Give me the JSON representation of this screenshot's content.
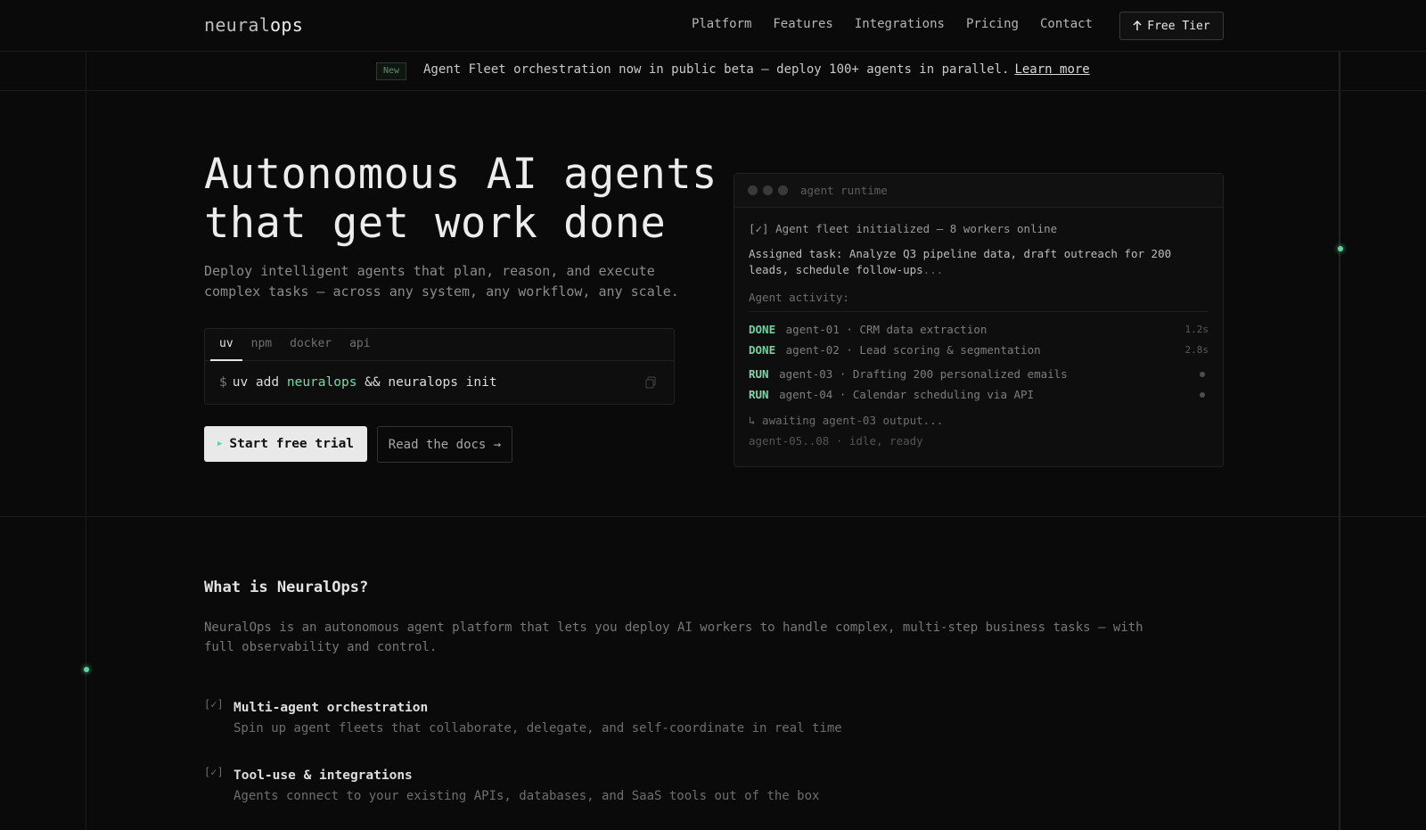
{
  "brand": {
    "logo_light": "neural",
    "logo_bold": "ops"
  },
  "nav": {
    "items": [
      "Platform",
      "Features",
      "Integrations",
      "Pricing",
      "Contact"
    ],
    "cta": "Free Tier",
    "cta_icon": "arrow-up-icon"
  },
  "banner": {
    "badge": "New",
    "text": "Agent Fleet orchestration now in public beta — deploy 100+ agents in parallel.",
    "link": "Learn more"
  },
  "hero": {
    "title_line1": "Autonomous AI agents",
    "title_line2": "that get work done",
    "subtitle": "Deploy intelligent agents that plan, reason, and execute complex tasks — across any system, any workflow, any scale.",
    "install": {
      "tabs": [
        "uv",
        "npm",
        "docker",
        "api"
      ],
      "active_tab": "uv",
      "prompt": "$",
      "cmd_pre": "uv add",
      "cmd_pkg": "neuralops",
      "cmd_post": "&& neuralops init"
    },
    "primary_button": "Start free trial",
    "secondary_button": "Read the docs →"
  },
  "terminal": {
    "title": "agent runtime",
    "init_line": "[✓] Agent fleet initialized — 8 workers online",
    "task": "Assigned task: Analyze Q3 pipeline data, draft outreach for 200 leads, schedule follow-ups",
    "task_ellipsis": "...",
    "activity_label": "Agent activity:",
    "rows": [
      {
        "status": "DONE",
        "text": "agent-01 · CRM data extraction",
        "time": "1.2s"
      },
      {
        "status": "DONE",
        "text": "agent-02 · Lead scoring & segmentation",
        "time": "2.8s"
      },
      {
        "status": "RUN",
        "text": "agent-03 · Drafting 200 personalized emails",
        "time": ""
      },
      {
        "status": "RUN",
        "text": "agent-04 · Calendar scheduling via API",
        "time": ""
      }
    ],
    "waiting": "↳ awaiting agent-03 output...",
    "idle": "agent-05..08 · idle, ready"
  },
  "about": {
    "title": "What is NeuralOps?",
    "description": "NeuralOps is an autonomous agent platform that lets you deploy AI workers to handle complex, multi-step business tasks — with full observability and control.",
    "features": [
      {
        "check": "[✓]",
        "title": "Multi-agent orchestration",
        "desc": "Spin up agent fleets that collaborate, delegate, and self-coordinate in real time"
      },
      {
        "check": "[✓]",
        "title": "Tool-use & integrations",
        "desc": "Agents connect to your existing APIs, databases, and SaaS tools out of the box"
      }
    ]
  },
  "colors": {
    "accent": "#5fd3a0",
    "background": "#0a0a0a"
  }
}
